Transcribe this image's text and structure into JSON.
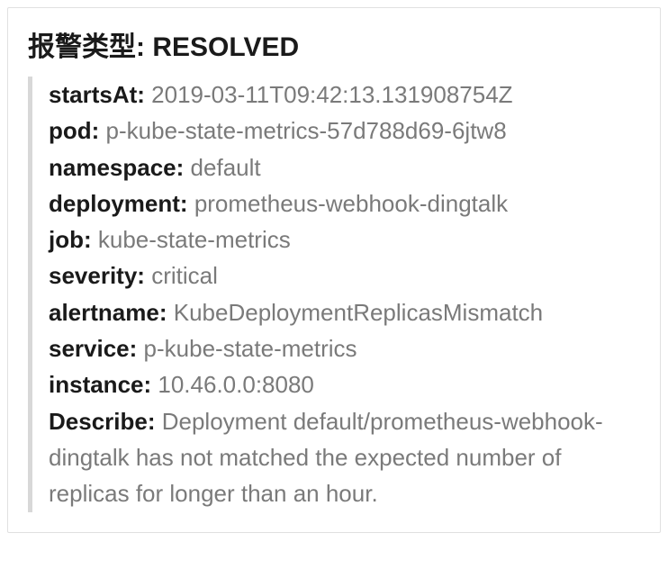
{
  "header": {
    "title_label": "报警类型:",
    "title_value": "RESOLVED"
  },
  "fields": [
    {
      "label": "startsAt:",
      "value": "2019-03-11T09:42:13.131908754Z"
    },
    {
      "label": "pod:",
      "value": "p-kube-state-metrics-57d788d69-6jtw8"
    },
    {
      "label": "namespace:",
      "value": "default"
    },
    {
      "label": "deployment:",
      "value": "prometheus-webhook-dingtalk"
    },
    {
      "label": "job:",
      "value": "kube-state-metrics"
    },
    {
      "label": "severity:",
      "value": "critical"
    },
    {
      "label": "alertname:",
      "value": "KubeDeploymentReplicasMismatch"
    },
    {
      "label": "service:",
      "value": "p-kube-state-metrics"
    },
    {
      "label": "instance:",
      "value": "10.46.0.0:8080"
    },
    {
      "label": "Describe:",
      "value": "Deployment default/prometheus-webhook-dingtalk has not matched the expected number of replicas for longer than an hour."
    }
  ]
}
